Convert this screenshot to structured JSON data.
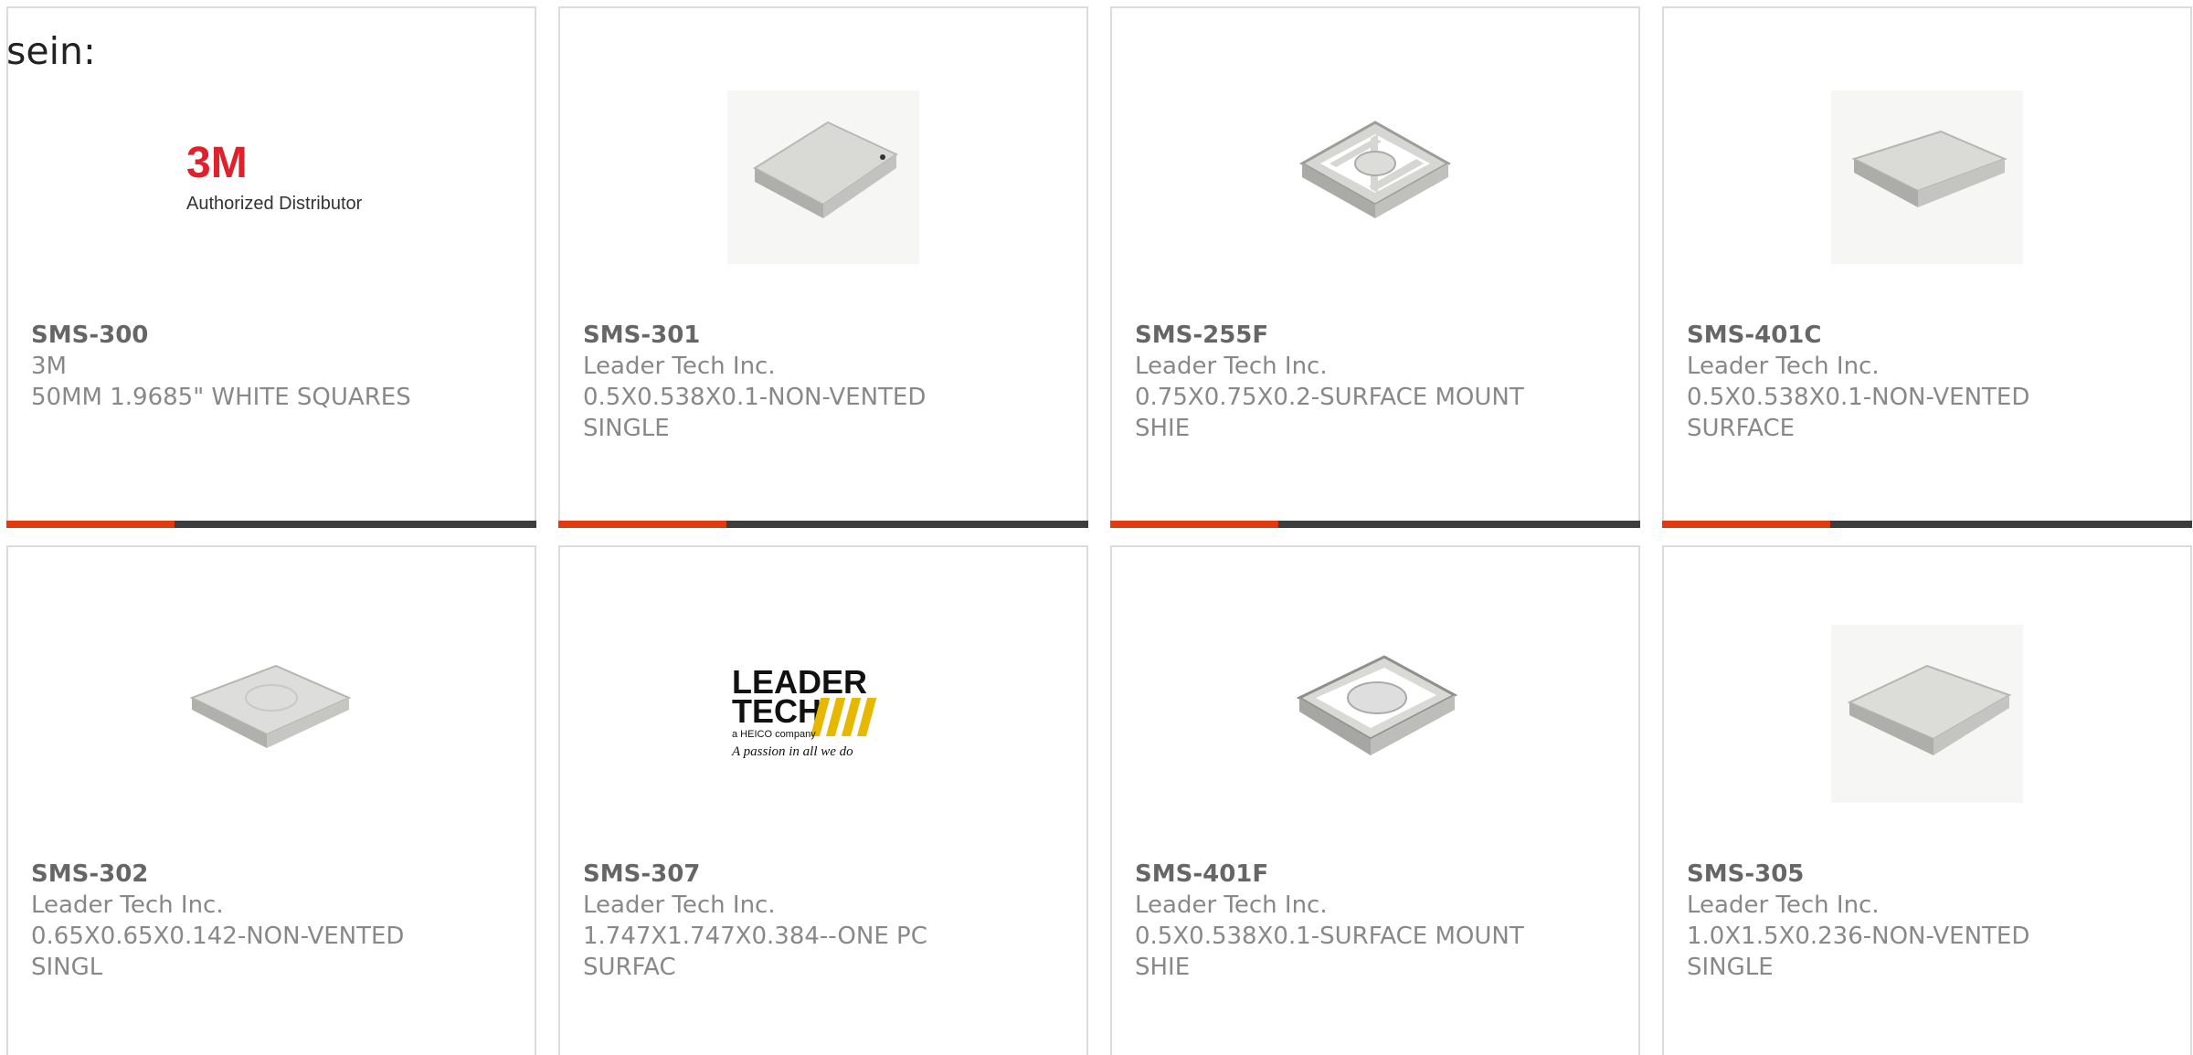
{
  "page": {
    "prefix_text": "sein:"
  },
  "accent_color": "#e03a10",
  "bar_color": "#3d3d3d",
  "products": [
    {
      "part": "SMS-300",
      "manufacturer": "3M",
      "description": "50MM 1.9685\" WHITE SQUARES",
      "image": "3m-authorized-distributor-logo",
      "logo_text": "3M",
      "logo_subtext": "Authorized Distributor"
    },
    {
      "part": "SMS-301",
      "manufacturer": "Leader Tech Inc.",
      "description": "0.5X0.538X0.1-NON-VENTED\nSINGLE",
      "image": "shield-can-closed-image"
    },
    {
      "part": "SMS-255F",
      "manufacturer": "Leader Tech Inc.",
      "description": "0.75X0.75X0.2-SURFACE MOUNT\nSHIE",
      "image": "shield-frame-cross-image"
    },
    {
      "part": "SMS-401C",
      "manufacturer": "Leader Tech Inc.",
      "description": "0.5X0.538X0.1-NON-VENTED\nSURFACE",
      "image": "shield-cover-image"
    },
    {
      "part": "SMS-302",
      "manufacturer": "Leader Tech Inc.",
      "description": "0.65X0.65X0.142-NON-VENTED\nSINGL",
      "image": "shield-can-flat-image"
    },
    {
      "part": "SMS-307",
      "manufacturer": "Leader Tech Inc.",
      "description": "1.747X1.747X0.384--ONE PC\nSURFAC",
      "image": "leader-tech-logo",
      "logo_line1": "LEADER",
      "logo_line2": "TECH",
      "logo_sub": "a HEICO company",
      "logo_tagline": "A passion in all we do"
    },
    {
      "part": "SMS-401F",
      "manufacturer": "Leader Tech Inc.",
      "description": "0.5X0.538X0.1-SURFACE MOUNT\nSHIE",
      "image": "shield-frame-disc-image"
    },
    {
      "part": "SMS-305",
      "manufacturer": "Leader Tech Inc.",
      "description": "1.0X1.5X0.236-NON-VENTED\nSINGLE",
      "image": "shield-can-rect-image"
    }
  ]
}
